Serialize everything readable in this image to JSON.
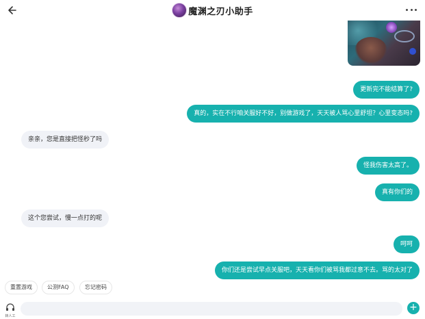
{
  "header": {
    "title": "魔渊之刃小助手",
    "back_icon": "arrow-left-icon",
    "more_icon": "more-horizontal-icon"
  },
  "colors": {
    "accent": "#17b1ae",
    "incoming_bubble": "#f0f2f7"
  },
  "messages": [
    {
      "from": "user",
      "text": "更新完不能结算了?"
    },
    {
      "from": "user",
      "text": "真的，实在不行咱关服好不好，别做游戏了，天天被人骂心里舒坦？心里变态吗?"
    },
    {
      "from": "bot",
      "text": "亲亲，您是直接把怪秒了吗"
    },
    {
      "from": "user",
      "text": "怪我伤害太高了。"
    },
    {
      "from": "user",
      "text": "真有你们的"
    },
    {
      "from": "bot",
      "text": "这个您尝试，慢一点打的呢"
    },
    {
      "from": "user",
      "text": "呵呵"
    },
    {
      "from": "user",
      "text": "你们还是尝试早点关服吧，天天看你们被骂我都过意不去。骂的太对了"
    }
  ],
  "quick_replies": [
    "重置游戏",
    "公测FAQ",
    "忘记密码"
  ],
  "input": {
    "placeholder": "",
    "agent_label": "转人工",
    "agent_icon": "headset-icon",
    "send_icon": "plus-icon",
    "send_label": "+"
  }
}
